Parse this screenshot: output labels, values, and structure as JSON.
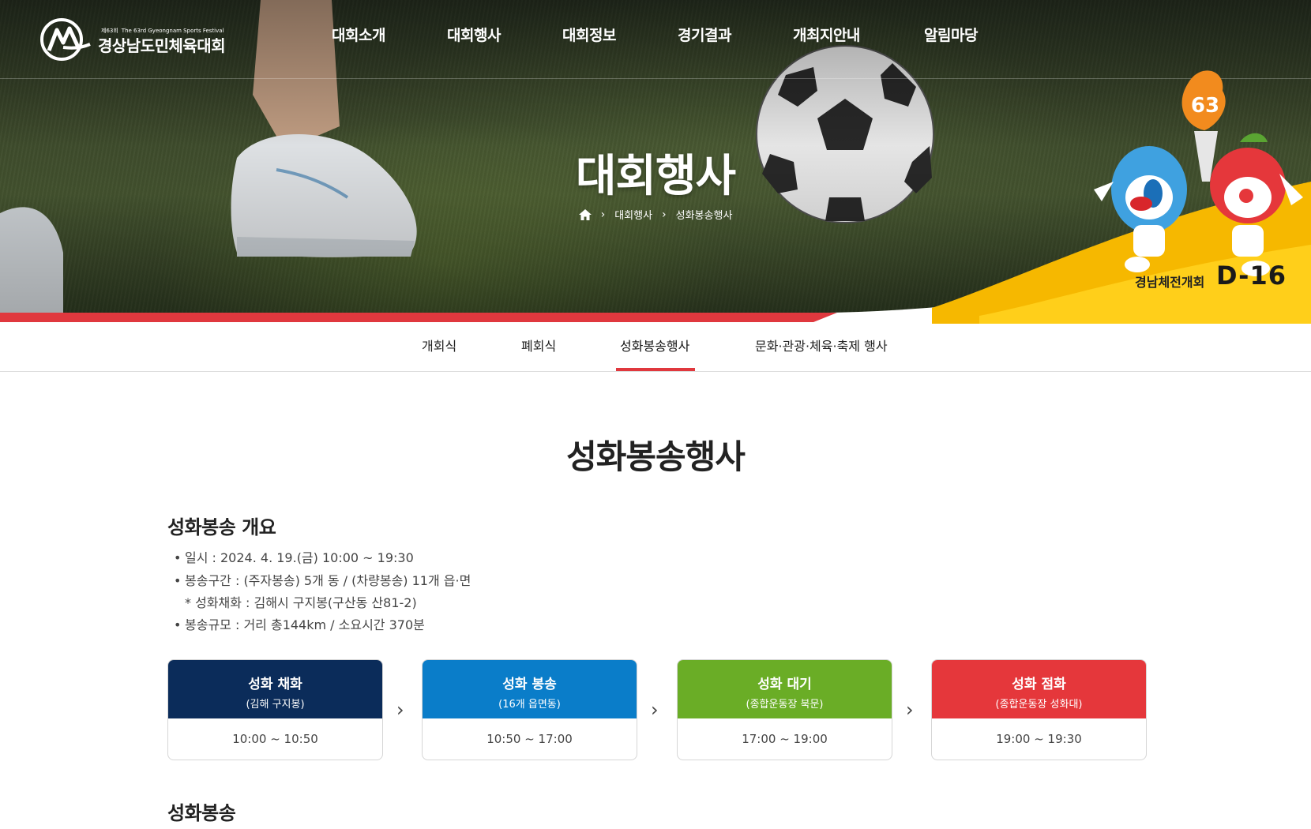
{
  "header": {
    "logo": {
      "edition": "제63회",
      "edition_en": "The 63rd Gyeongnam Sports Festival",
      "name": "경상남도민체육대회"
    },
    "nav": [
      "대회소개",
      "대회행사",
      "대회정보",
      "경기결과",
      "개최지안내",
      "알림마당"
    ]
  },
  "hero": {
    "title": "대회행사",
    "breadcrumb": [
      "대회행사",
      "성화봉송행사"
    ],
    "dday_label": "경남체전개회",
    "dday_value": "D-16",
    "torch_number": "63"
  },
  "tabs": {
    "items": [
      "개회식",
      "폐회식",
      "성화봉송행사",
      "문화·관광·체육·축제 행사"
    ],
    "active_index": 2
  },
  "page": {
    "title": "성화봉송행사",
    "overview_title": "성화봉송 개요",
    "overview": {
      "line1": "일시 : 2024. 4. 19.(금) 10:00 ~ 19:30",
      "line2": "봉송구간 : (주자봉송) 5개 동 / (차량봉송) 11개 읍·면",
      "note": "* 성화채화 : 김해시 구지봉(구산동 산81-2)",
      "line3": "봉송규모 : 거리 총144km / 소요시간 370분"
    },
    "steps": [
      {
        "title": "성화 채화",
        "sub": "(김해 구지봉)",
        "time": "10:00 ~ 10:50",
        "color": "#0b2c5a"
      },
      {
        "title": "성화 봉송",
        "sub": "(16개 읍면동)",
        "time": "10:50 ~ 17:00",
        "color": "#0a7dc9"
      },
      {
        "title": "성화 대기",
        "sub": "(종합운동장 북문)",
        "time": "17:00 ~ 19:00",
        "color": "#6aad26"
      },
      {
        "title": "성화 점화",
        "sub": "(종합운동장 성화대)",
        "time": "19:00 ~ 19:30",
        "color": "#e5373b"
      }
    ],
    "section2_title": "성화봉송"
  },
  "colors": {
    "accent_red": "#e0383e",
    "band_yellow": "#f6b800"
  }
}
